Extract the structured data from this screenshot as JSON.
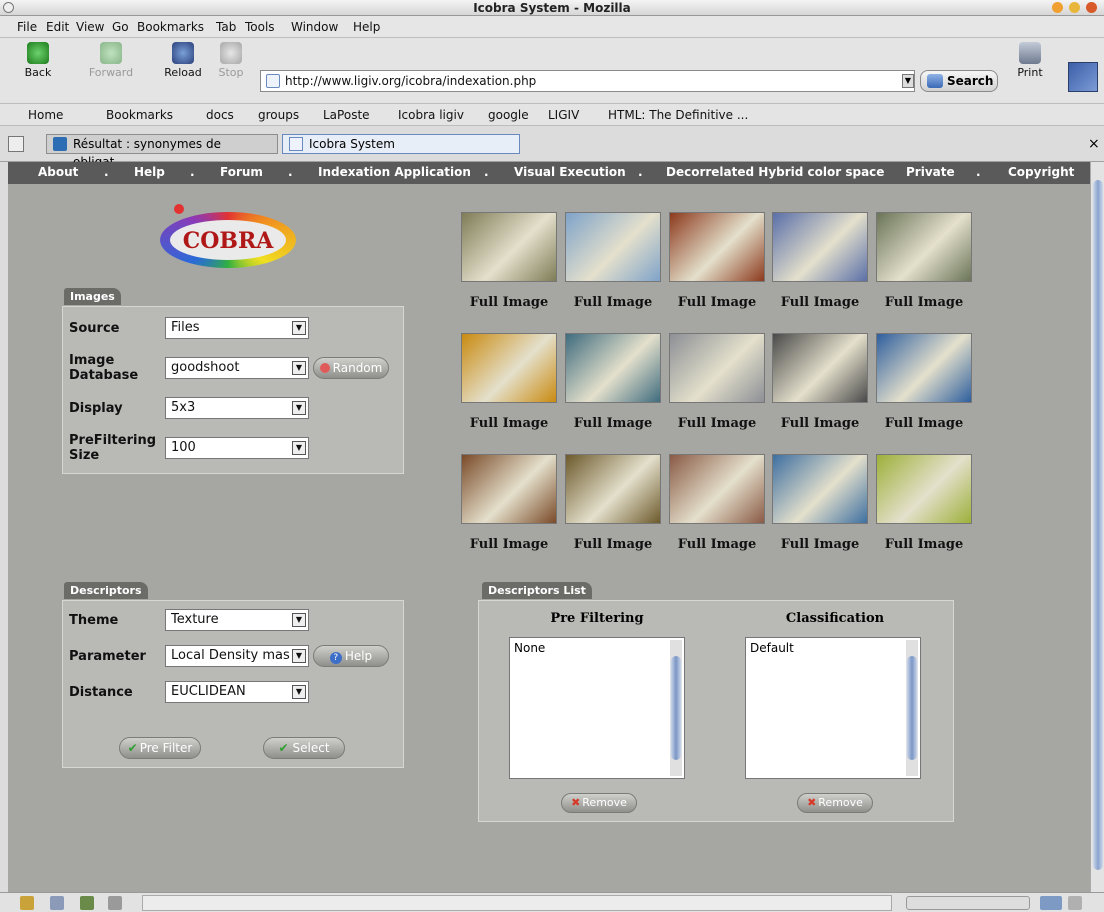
{
  "window": {
    "title": "Icobra System - Mozilla"
  },
  "menu": [
    "File",
    "Edit",
    "View",
    "Go",
    "Bookmarks",
    "Tab",
    "Tools",
    "Window",
    "Help"
  ],
  "nav": {
    "back": "Back",
    "forward": "Forward",
    "reload": "Reload",
    "stop": "Stop",
    "url": "http://www.ligiv.org/icobra/indexation.php",
    "search": "Search",
    "print": "Print"
  },
  "bookmarks": [
    "Home",
    "Bookmarks",
    "docs",
    "groups",
    "LaPoste",
    "Icobra ligiv",
    "google",
    "LIGIV",
    "HTML: The Definitive ..."
  ],
  "tabs": {
    "tab1": "Résultat : synonymes de obligat...",
    "tab2": "Icobra System",
    "close": "×"
  },
  "site_nav": [
    "About",
    ".",
    "Help",
    ".",
    "Forum",
    ".",
    "Indexation Application",
    ".",
    "Visual Execution",
    ".",
    "Decorrelated Hybrid color space",
    "Private",
    ".",
    "Copyright"
  ],
  "logo": {
    "text": "COBRA"
  },
  "images_panel": {
    "title": "Images",
    "source_label": "Source",
    "source_value": "Files",
    "db_label": "Image Database",
    "db_value": "goodshoot",
    "random_label": "Random",
    "display_label": "Display",
    "display_value": "5x3",
    "prefilter_label": "PreFiltering Size",
    "prefilter_value": "100"
  },
  "descriptors_panel": {
    "title": "Descriptors",
    "theme_label": "Theme",
    "theme_value": "Texture",
    "param_label": "Parameter",
    "param_value": "Local Density mas",
    "help_label": "Help",
    "distance_label": "Distance",
    "distance_value": "EUCLIDEAN",
    "prefilter_btn": "Pre Filter",
    "select_btn": "Select"
  },
  "descriptors_list": {
    "title": "Descriptors List",
    "pre_header": "Pre Filtering",
    "class_header": "Classification",
    "pre_items": [
      "None"
    ],
    "class_items": [
      "Default"
    ],
    "remove": "Remove"
  },
  "gallery": {
    "caption": "Full Image",
    "colors": [
      [
        "#7f7c57",
        "#7fa3c9",
        "#8c3a1d",
        "#5a6fa8",
        "#6a7458"
      ],
      [
        "#c98a10",
        "#3f6c7e",
        "#8c8f95",
        "#4a4a4a",
        "#2f5f9e"
      ],
      [
        "#7a4a28",
        "#6d5a2c",
        "#8a5a45",
        "#3e6fa0",
        "#9db03a"
      ]
    ]
  },
  "colors": {
    "navbar": "#5a5a5a",
    "page_bg": "#a6a7a2",
    "panel_bg": "#b9bab5"
  }
}
